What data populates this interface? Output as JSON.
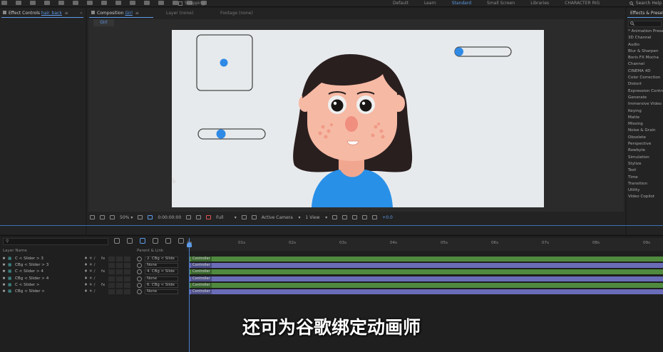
{
  "topbar": {
    "snapping": "Snapping",
    "workspaces": [
      "Default",
      "Learn",
      "Standard",
      "Small Screen",
      "Libraries",
      "CHARACTER RIG"
    ],
    "active_workspace": "Standard",
    "search_help": "Search Help"
  },
  "left_panel": {
    "tab_label": "Effect Controls",
    "tab_target": "hair_back"
  },
  "comp_panel": {
    "tab_label": "Composition",
    "tab_target": "Girl",
    "layer_tab": "Layer (none)",
    "footage_tab": "Footage (none)",
    "sub_tab": "Girl"
  },
  "comp_toolbar": {
    "zoom": "50%",
    "timecode": "0:00:00:00",
    "resolution": "Full",
    "camera": "Active Camera",
    "views": "1 View",
    "exposure": "+0.0"
  },
  "effects_panel": {
    "title": "Effects & Presets",
    "search_placeholder": "",
    "items": [
      "* Animation Presets",
      "3D Channel",
      "Audio",
      "Blur & Sharpen",
      "Boris FX Mocha",
      "Channel",
      "CINEMA 4D",
      "Color Correction",
      "Distort",
      "Expression Controls",
      "Generate",
      "Immersive Video",
      "Keying",
      "Matte",
      "Missing",
      "Noise & Grain",
      "Obsolete",
      "Perspective",
      "Rowbyte",
      "Simulation",
      "Stylize",
      "Text",
      "Time",
      "Transition",
      "Utility",
      "Video Copilot"
    ]
  },
  "timeline": {
    "search_placeholder": "",
    "col_layer_name": "Layer Name",
    "col_parent": "Parent & Link",
    "ruler_ticks": [
      "0s",
      "01s",
      "02s",
      "03s",
      "04s",
      "05s",
      "06s",
      "07s",
      "08s",
      "09s"
    ],
    "layers": [
      {
        "name": "C < Slider > 3",
        "fx": "fx",
        "parent": "2. CBg < Slide",
        "bar_color": "#4f8a3f",
        "bar_label": "Controller"
      },
      {
        "name": "CBg < Slider > 3",
        "fx": "",
        "parent": "None",
        "bar_color": "#6a6cb8",
        "bar_label": "Controller"
      },
      {
        "name": "C < Slider > 4",
        "fx": "fx",
        "parent": "4. CBg < Slide",
        "bar_color": "#4f8a3f",
        "bar_label": "Controller"
      },
      {
        "name": "CBg < Slider > 4",
        "fx": "",
        "parent": "None",
        "bar_color": "#6a6cb8",
        "bar_label": "Controller"
      },
      {
        "name": "C < Slider >",
        "fx": "fx",
        "parent": "6. CBg < Slide",
        "bar_color": "#4f8a3f",
        "bar_label": "Controller"
      },
      {
        "name": "CBg < Slider >",
        "fx": "",
        "parent": "None",
        "bar_color": "#6a6cb8",
        "bar_label": "Controller"
      }
    ]
  },
  "subtitle": "还可为谷歌绑定动画师",
  "colors": {
    "accent": "#5d9be8",
    "canvas": "#e7eaec",
    "hair": "#2a1f1f",
    "skin": "#f6b9a4",
    "shirt": "#2990e8",
    "slider_knob": "#2f8ae6"
  }
}
